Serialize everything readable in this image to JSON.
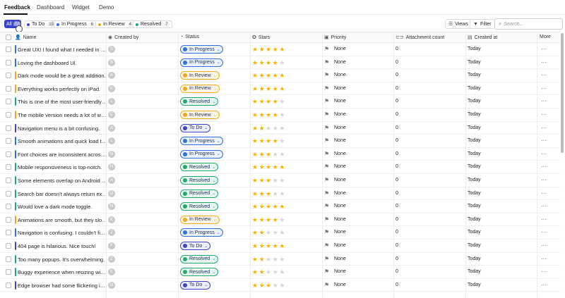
{
  "tabs": [
    {
      "label": "Feedback",
      "active": true
    },
    {
      "label": "Dashboard",
      "active": false
    },
    {
      "label": "Widget",
      "active": false
    },
    {
      "label": "Demo",
      "active": false
    }
  ],
  "filters": {
    "all": {
      "label": "All",
      "count": "72"
    },
    "todo": {
      "label": "To Do",
      "count": "15",
      "color": "#3b44c7"
    },
    "in_progress": {
      "label": "In Progress",
      "count": "6",
      "color": "#2f6fe0"
    },
    "in_review": {
      "label": "In Review",
      "count": "4",
      "color": "#f0a91a"
    },
    "resolved": {
      "label": "Resolved",
      "count": "7",
      "color": "#22a86b"
    }
  },
  "toolbar": {
    "views_label": "Views",
    "filter_label": "Filter",
    "search_placeholder": "Search..."
  },
  "columns": {
    "name": "Name",
    "created_by": "Created by",
    "status": "Status",
    "stars": "Stars",
    "priority": "Priority",
    "attachment_count": "Attachment count",
    "created_at": "Created at",
    "more": "More"
  },
  "status_styles": {
    "In Progress": {
      "color": "#2f6fe0",
      "bg": "#eaf1ff"
    },
    "In Review": {
      "color": "#f0a91a",
      "bg": "#fff7e6"
    },
    "Resolved": {
      "color": "#22a86b",
      "bg": "#e7f7ef"
    },
    "To Do": {
      "color": "#3b44c7",
      "bg": "#ecedfb"
    }
  },
  "rows": [
    {
      "name": "Great UX! I found what I needed in under a minute.",
      "avatar": "S",
      "status": "In Progress",
      "stars": 5,
      "priority": "None",
      "attachments": "0",
      "created": "Today"
    },
    {
      "name": "Loving the dashboard UI.",
      "avatar": "B",
      "status": "In Progress",
      "stars": 4,
      "priority": "None",
      "attachments": "0",
      "created": "Today"
    },
    {
      "name": "Dark mode would be a great addition.",
      "avatar": "A",
      "status": "In Review",
      "stars": 5,
      "priority": "None",
      "attachments": "0",
      "created": "Today"
    },
    {
      "name": "Everything works perfectly on iPad.",
      "avatar": "K",
      "status": "In Review",
      "stars": 5,
      "priority": "None",
      "attachments": "0",
      "created": "Today"
    },
    {
      "name": "This is one of the most user-friendly apps.",
      "avatar": "L",
      "status": "Resolved",
      "stars": 4,
      "priority": "None",
      "attachments": "0",
      "created": "Today"
    },
    {
      "name": "The mobile version needs a lot of work.",
      "avatar": "E",
      "status": "In Review",
      "stars": 4,
      "priority": "None",
      "attachments": "0",
      "created": "Today"
    },
    {
      "name": "Navigation menu is a bit confusing.",
      "avatar": "A",
      "status": "To Do",
      "stars": 2,
      "priority": "None",
      "attachments": "0",
      "created": "Today"
    },
    {
      "name": "Smooth animations and quick load times.",
      "avatar": "L",
      "status": "In Progress",
      "stars": 4,
      "priority": "None",
      "attachments": "0",
      "created": "Today"
    },
    {
      "name": "Font choices are inconsistent across pages.",
      "avatar": "N",
      "status": "In Progress",
      "stars": 3,
      "priority": "None",
      "attachments": "0",
      "created": "Today"
    },
    {
      "name": "Mobile responsiveness is top-notch.",
      "avatar": "H",
      "status": "Resolved",
      "stars": 5,
      "priority": "None",
      "attachments": "0",
      "created": "Today"
    },
    {
      "name": "Some elements overlap on Android devices.",
      "avatar": "A",
      "status": "Resolved",
      "stars": 3,
      "priority": "None",
      "attachments": "0",
      "created": "Today"
    },
    {
      "name": "Search bar doesn't always return expected results.",
      "avatar": "D",
      "status": "Resolved",
      "stars": 3,
      "priority": "None",
      "attachments": "0",
      "created": "Today"
    },
    {
      "name": "Would love a dark mode toggle.",
      "avatar": "N",
      "status": "Resolved",
      "stars": 5,
      "priority": "None",
      "attachments": "0",
      "created": "Today"
    },
    {
      "name": "Animations are smooth, but they slow things down.",
      "avatar": "K",
      "status": "In Review",
      "stars": 4,
      "priority": "None",
      "attachments": "0",
      "created": "Today"
    },
    {
      "name": "Navigation is confusing. I couldn't find settings.",
      "avatar": "J",
      "status": "In Progress",
      "stars": 2,
      "priority": "None",
      "attachments": "0",
      "created": "Today"
    },
    {
      "name": "404 page is hilarious. Nice touch!",
      "avatar": "F",
      "status": "To Do",
      "stars": 5,
      "priority": "None",
      "attachments": "0",
      "created": "Today"
    },
    {
      "name": "Too many popups. It's overwhelming.",
      "avatar": "Z",
      "status": "Resolved",
      "stars": 2,
      "priority": "None",
      "attachments": "0",
      "created": "Today"
    },
    {
      "name": "Buggy experience when resizing windows.",
      "avatar": "K",
      "status": "Resolved",
      "stars": 2,
      "priority": "None",
      "attachments": "0",
      "created": "Today"
    },
    {
      "name": "Edge browser had some flickering issues.",
      "avatar": "O",
      "status": "To Do",
      "stars": 3,
      "priority": "None",
      "attachments": "0",
      "created": "Today"
    }
  ]
}
